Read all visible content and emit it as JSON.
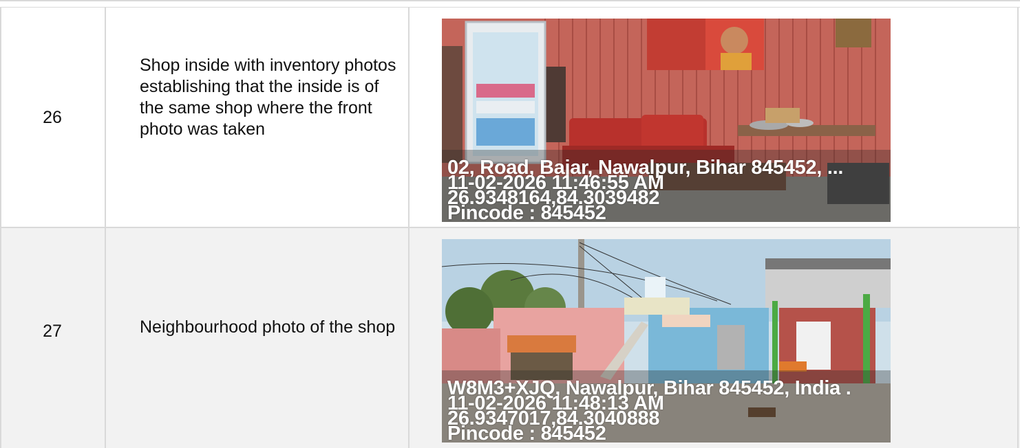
{
  "rows": [
    {
      "number": "26",
      "description": "Shop inside with inventory photos establishing that the inside is of the same shop where the front photo was taken",
      "photo": {
        "subject": "shop-interior",
        "overlay": {
          "address": "02, Road, Bajar, Nawalpur, Bihar 845452, ...",
          "datetime": "11-02-2026 11:46:55 AM",
          "coords": "26.9348164,84.3039482",
          "pincode": "Pincode : 845452"
        }
      }
    },
    {
      "number": "27",
      "description": "Neighbourhood photo of the shop",
      "photo": {
        "subject": "neighbourhood-street",
        "overlay": {
          "address": "W8M3+XJQ, Nawalpur, Bihar 845452, India .",
          "datetime": "11-02-2026 11:48:13 AM",
          "coords": "26.9347017,84.3040888",
          "pincode": "Pincode : 845452"
        }
      }
    }
  ]
}
